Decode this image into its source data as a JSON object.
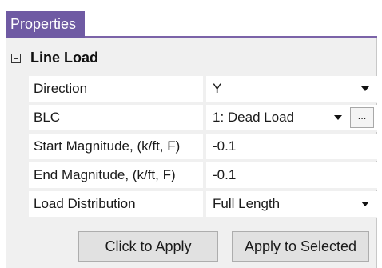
{
  "panel": {
    "tab_label": "Properties"
  },
  "group": {
    "label": "Line Load"
  },
  "properties": [
    {
      "name": "Direction",
      "value": "Y",
      "control": "dropdown"
    },
    {
      "name": "BLC",
      "value": "1: Dead Load",
      "control": "dropdown-with-browse",
      "browse_label": "..."
    },
    {
      "name": "Start Magnitude, (k/ft, F)",
      "value": "-0.1",
      "control": "text"
    },
    {
      "name": "End Magnitude, (k/ft, F)",
      "value": "-0.1",
      "control": "text"
    },
    {
      "name": "Load Distribution",
      "value": "Full Length",
      "control": "dropdown"
    }
  ],
  "buttons": {
    "click_to_apply": "Click to Apply",
    "apply_to_selected": "Apply to Selected"
  },
  "colors": {
    "tab_accent": "#6f5aa3"
  },
  "icons": {
    "collapse": "minus-box-icon",
    "dropdown": "chevron-down-icon"
  }
}
